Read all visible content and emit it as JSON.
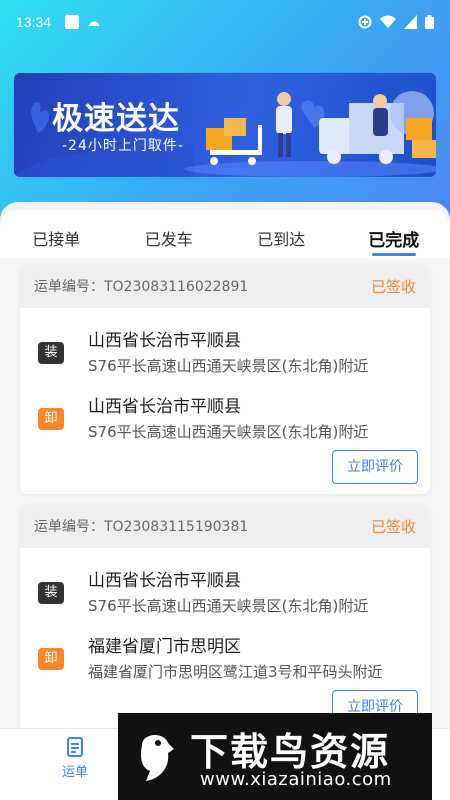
{
  "status_bar": {
    "time": "13:34"
  },
  "banner": {
    "title": "极速送达",
    "subtitle": "-24小时上门取件-"
  },
  "tabs": [
    {
      "label": "已接单"
    },
    {
      "label": "已发车"
    },
    {
      "label": "已到达"
    },
    {
      "label": "已完成",
      "active": true
    }
  ],
  "orders": [
    {
      "number_label": "运单编号：TO23083116022891",
      "status": "已签收",
      "stops": [
        {
          "badge": "装",
          "type": "load",
          "city": "山西省长治市平顺县",
          "address": "S76平长高速山西通天峡景区(东北角)附近"
        },
        {
          "badge": "卸",
          "type": "unload",
          "city": "山西省长治市平顺县",
          "address": "S76平长高速山西通天峡景区(东北角)附近"
        }
      ],
      "action": "立即评价"
    },
    {
      "number_label": "运单编号：TO23083115190381",
      "status": "已签收",
      "stops": [
        {
          "badge": "装",
          "type": "load",
          "city": "山西省长治市平顺县",
          "address": "S76平长高速山西通天峡景区(东北角)附近"
        },
        {
          "badge": "卸",
          "type": "unload",
          "city": "福建省厦门市思明区",
          "address": "福建省厦门市思明区鹭江道3号和平码头附近"
        }
      ],
      "action": "立即评价"
    }
  ],
  "bottom_nav": {
    "label": "运单"
  },
  "watermark": {
    "title": "下载鸟资源",
    "url": "www.xiazainiao.com"
  },
  "colors": {
    "accent": "#3b82f6",
    "status": "#f5882b",
    "load_badge": "#333333",
    "unload_badge": "#f5882b"
  }
}
